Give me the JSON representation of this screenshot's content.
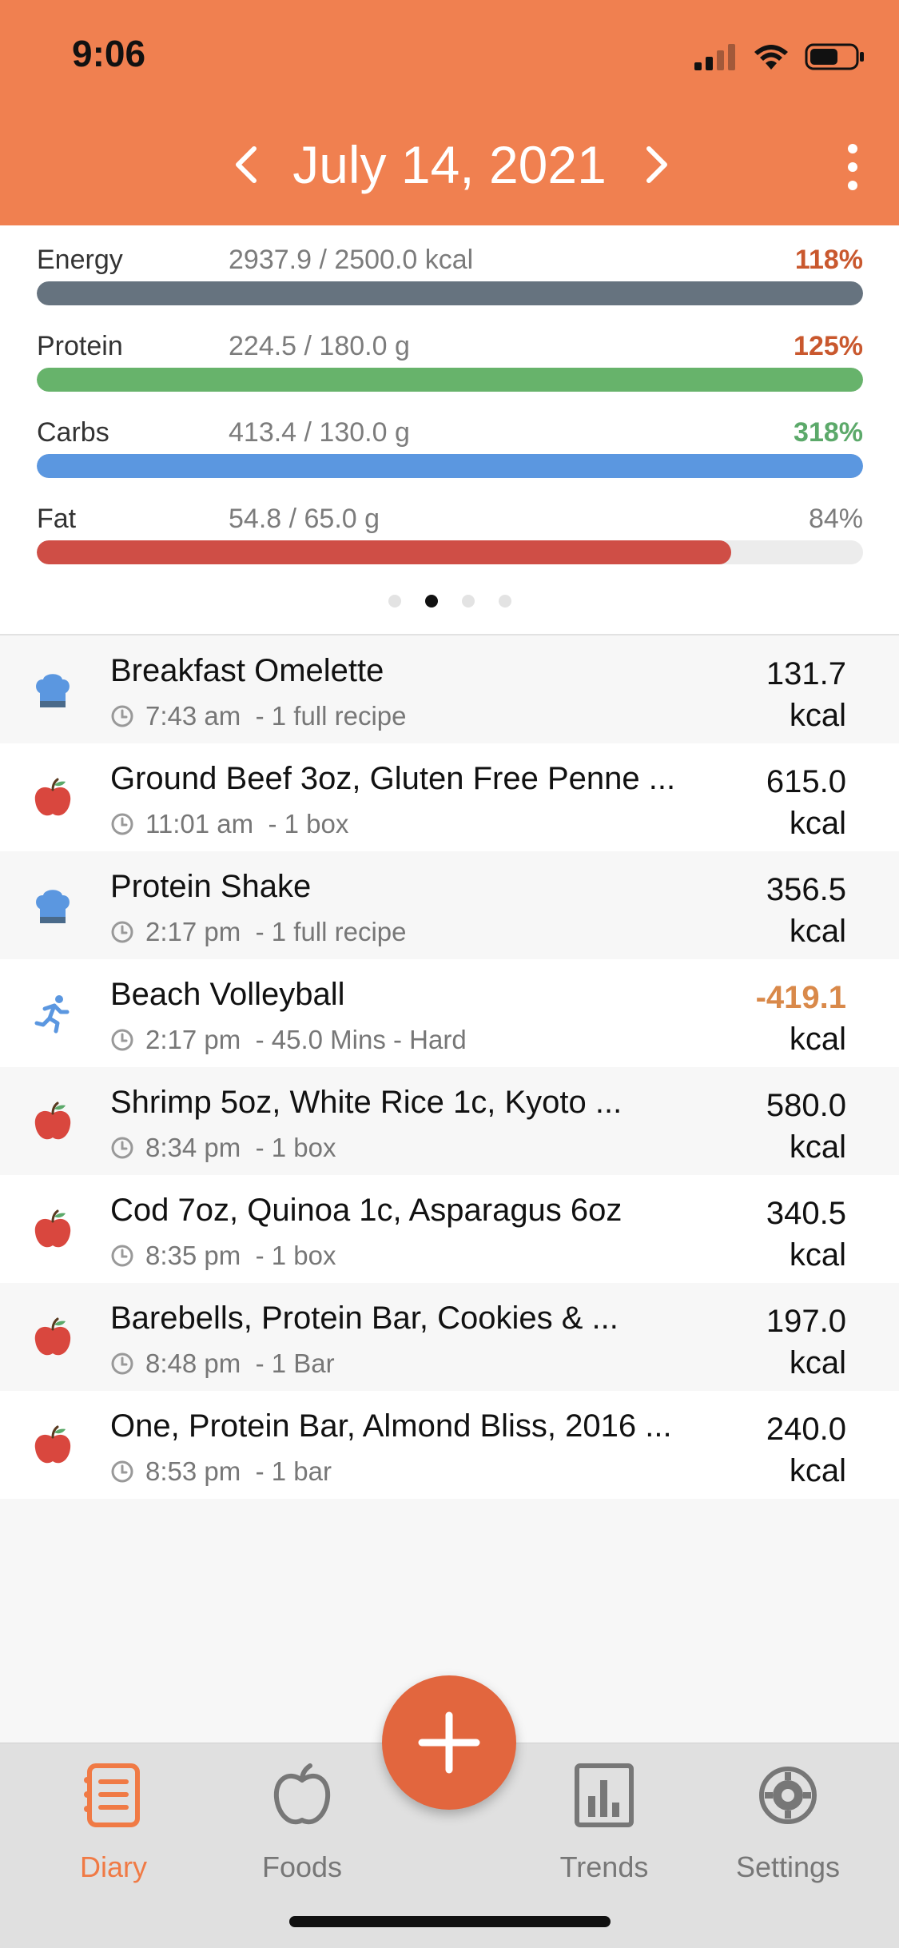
{
  "status_bar": {
    "time": "9:06"
  },
  "header": {
    "date": "July 14, 2021"
  },
  "macros": [
    {
      "name": "Energy",
      "amount": "2937.9 / 2500.0 kcal",
      "percent_label": "118%",
      "fill": 1.0,
      "bar_color": "#66737F",
      "pct_color": "#C9582E"
    },
    {
      "name": "Protein",
      "amount": "224.5 / 180.0 g",
      "percent_label": "125%",
      "fill": 1.0,
      "bar_color": "#67B36B",
      "pct_color": "#C9582E"
    },
    {
      "name": "Carbs",
      "amount": "413.4 / 130.0 g",
      "percent_label": "318%",
      "fill": 1.0,
      "bar_color": "#5B97E0",
      "pct_color": "#5CA96A"
    },
    {
      "name": "Fat",
      "amount": "54.8 / 65.0 g",
      "percent_label": "84%",
      "fill": 0.84,
      "bar_color": "#CF4E46",
      "pct_color": "#7c7c7c"
    }
  ],
  "page_indicator": {
    "count": 4,
    "active": 1
  },
  "entries": [
    {
      "icon": "chef-hat-icon",
      "title": "Breakfast Omelette",
      "time": "7:43 am",
      "detail": "- 1 full recipe",
      "kcal": "131.7",
      "unit": "kcal",
      "negative": false
    },
    {
      "icon": "apple-icon",
      "title": "Ground Beef 3oz, Gluten Free Penne ...",
      "time": "11:01 am",
      "detail": "- 1 box",
      "kcal": "615.0",
      "unit": "kcal",
      "negative": false
    },
    {
      "icon": "chef-hat-icon",
      "title": "Protein Shake",
      "time": "2:17 pm",
      "detail": "- 1 full recipe",
      "kcal": "356.5",
      "unit": "kcal",
      "negative": false
    },
    {
      "icon": "running-icon",
      "title": "Beach Volleyball",
      "time": "2:17 pm",
      "detail": "- 45.0 Mins - Hard",
      "kcal": "-419.1",
      "unit": "kcal",
      "negative": true
    },
    {
      "icon": "apple-icon",
      "title": "Shrimp 5oz, White Rice 1c, Kyoto ...",
      "time": "8:34 pm",
      "detail": "- 1 box",
      "kcal": "580.0",
      "unit": "kcal",
      "negative": false
    },
    {
      "icon": "apple-icon",
      "title": "Cod 7oz, Quinoa 1c, Asparagus 6oz",
      "time": "8:35 pm",
      "detail": "- 1 box",
      "kcal": "340.5",
      "unit": "kcal",
      "negative": false
    },
    {
      "icon": "apple-icon",
      "title": "Barebells, Protein Bar, Cookies & ...",
      "time": "8:48 pm",
      "detail": "- 1 Bar",
      "kcal": "197.0",
      "unit": "kcal",
      "negative": false
    },
    {
      "icon": "apple-icon",
      "title": "One, Protein Bar, Almond Bliss, 2016 ...",
      "time": "8:53 pm",
      "detail": "- 1 bar",
      "kcal": "240.0",
      "unit": "kcal",
      "negative": false
    }
  ],
  "tabs": [
    {
      "label": "Diary",
      "icon": "diary-icon",
      "active": true
    },
    {
      "label": "Foods",
      "icon": "apple-outline-icon",
      "active": false
    },
    {
      "label": "Trends",
      "icon": "bar-chart-icon",
      "active": false
    },
    {
      "label": "Settings",
      "icon": "gear-icon",
      "active": false
    }
  ],
  "colors": {
    "header": "#F08050",
    "accent": "#E2663E"
  }
}
